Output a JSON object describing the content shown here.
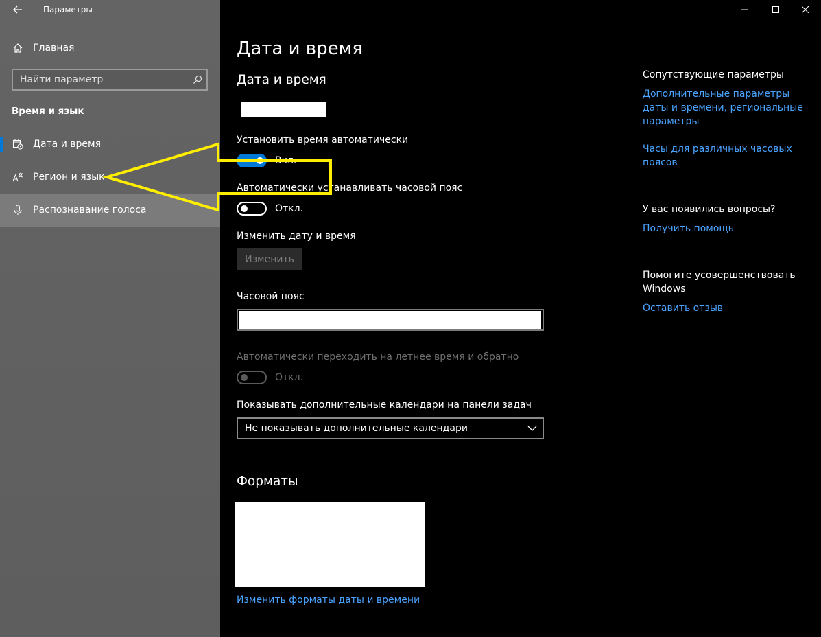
{
  "titlebar": {
    "back_icon": "back-arrow-icon",
    "title": "Параметры"
  },
  "window_controls": [
    {
      "name": "minimize-button",
      "icon": "minimize-icon"
    },
    {
      "name": "maximize-button",
      "icon": "maximize-icon"
    },
    {
      "name": "close-button",
      "icon": "close-icon"
    }
  ],
  "sidebar": {
    "home_label": "Главная",
    "search_placeholder": "Найти параметр",
    "section_title": "Время и язык",
    "items": [
      {
        "label": "Дата и время",
        "icon": "clock-calendar-icon",
        "active": true
      },
      {
        "label": "Регион и язык",
        "icon": "region-language-icon",
        "active": false
      },
      {
        "label": "Распознавание голоса",
        "icon": "microphone-icon",
        "active": false
      }
    ]
  },
  "main": {
    "page_title": "Дата и время",
    "section_datetime": "Дата и время",
    "auto_time": {
      "label": "Установить время автоматически",
      "state_label": "Вкл.",
      "on": true
    },
    "auto_timezone": {
      "label": "Автоматически устанавливать часовой пояс",
      "state_label": "Откл.",
      "on": false
    },
    "change_datetime": {
      "label": "Изменить дату и время",
      "button_label": "Изменить"
    },
    "timezone": {
      "label": "Часовой пояс"
    },
    "dst": {
      "label": "Автоматически переходить на летнее время и обратно",
      "state_label": "Откл.",
      "on": false,
      "disabled": true
    },
    "calendars": {
      "label": "Показывать дополнительные календари на панели задач",
      "selected": "Не показывать дополнительные календари"
    },
    "formats": {
      "title": "Форматы",
      "link": "Изменить форматы даты и времени"
    }
  },
  "related": {
    "heading": "Сопутствующие параметры",
    "link_additional": "Дополнительные параметры даты и времени, региональные параметры",
    "link_clocks": "Часы для различных часовых поясов",
    "questions_heading": "У вас появились вопросы?",
    "link_help": "Получить помощь",
    "improve_heading": "Помогите усовершенствовать Windows",
    "link_feedback": "Оставить отзыв"
  },
  "colors": {
    "accent": "#0078d7",
    "link": "#4aa3ff",
    "sidebar_bg": "#636363",
    "annotation": "#ffee00"
  }
}
